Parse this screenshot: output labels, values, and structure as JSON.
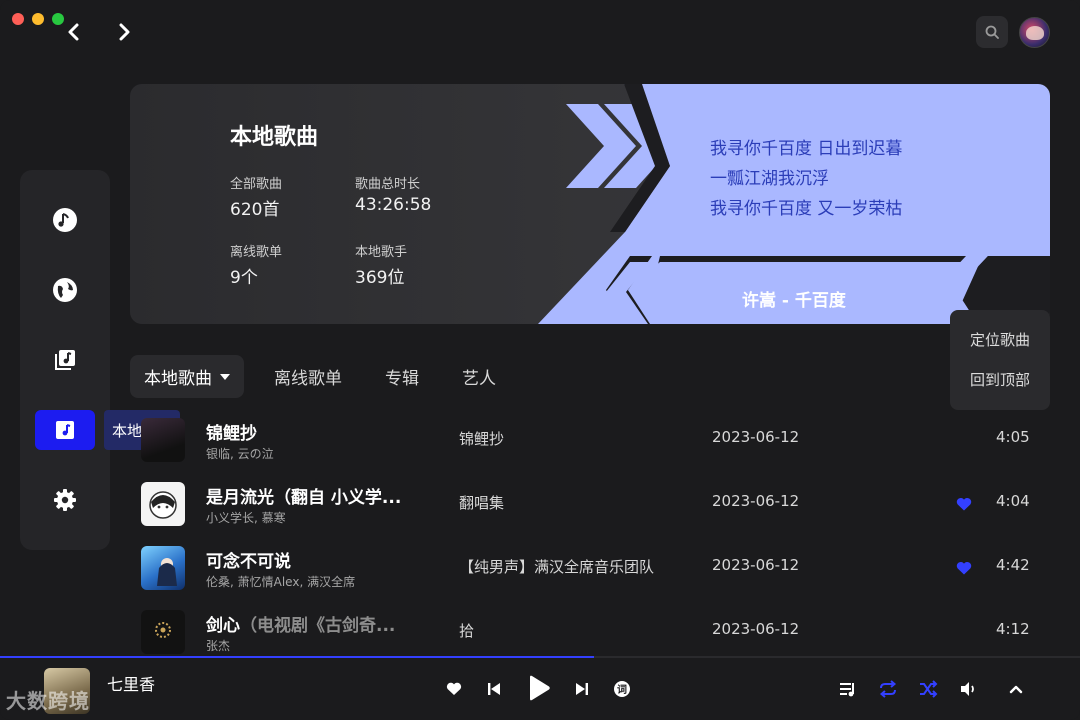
{
  "window": {
    "title": "本地音乐"
  },
  "sidebar": {
    "items": [
      {
        "icon": "music-note-circle-icon",
        "active": false
      },
      {
        "icon": "globe-icon",
        "active": false
      },
      {
        "icon": "music-library-icon",
        "active": false
      },
      {
        "icon": "local-music-icon",
        "active": true
      },
      {
        "icon": "gear-icon",
        "active": false
      }
    ],
    "tooltip": "本地音乐"
  },
  "banner": {
    "title": "本地歌曲",
    "stats": [
      {
        "label": "全部歌曲",
        "value": "620首"
      },
      {
        "label": "歌曲总时长",
        "value": "43:26:58"
      },
      {
        "label": "离线歌单",
        "value": "9个"
      },
      {
        "label": "本地歌手",
        "value": "369位"
      }
    ],
    "lyrics": [
      "我寻你千百度 日出到迟暮",
      "一瓢江湖我沉浮",
      "我寻你千百度 又一岁荣枯"
    ],
    "song_credit": "许嵩 - 千百度",
    "accent_color": "#aab8ff"
  },
  "tabs": [
    {
      "label": "本地歌曲",
      "active": true
    },
    {
      "label": "离线歌单",
      "active": false
    },
    {
      "label": "专辑",
      "active": false
    },
    {
      "label": "艺人",
      "active": false
    }
  ],
  "context_menu": {
    "items": [
      "定位歌曲",
      "回到顶部"
    ]
  },
  "songs": [
    {
      "title": "锦鲤抄",
      "title_sub": "",
      "artist": "银临, 云の泣",
      "album": "锦鲤抄",
      "date": "2023-06-12",
      "liked": false,
      "duration": "4:05"
    },
    {
      "title": "是月流光（翻自 小义学...",
      "title_sub": "",
      "artist": "小义学长, 慕寒",
      "album": "翻唱集",
      "date": "2023-06-12",
      "liked": true,
      "duration": "4:04"
    },
    {
      "title": "可念不可说",
      "title_sub": "",
      "artist": "伦桑, 萧忆情Alex, 满汉全席",
      "album": "【纯男声】满汉全席音乐团队",
      "date": "2023-06-12",
      "liked": true,
      "duration": "4:42"
    },
    {
      "title": "剑心",
      "title_sub": "（电视剧《古剑奇...",
      "artist": "张杰",
      "album": "拾",
      "date": "2023-06-12",
      "liked": false,
      "duration": "4:12"
    }
  ],
  "player": {
    "title": "七里香",
    "watermark": "大数跨境",
    "progress": 0.55,
    "like_color": "#ffffff",
    "accent_color": "#3340ff",
    "controls": [
      "heart-icon",
      "previous-icon",
      "play-icon",
      "next-icon",
      "lyrics-icon",
      "playlist-icon",
      "repeat-icon",
      "shuffle-icon",
      "volume-icon",
      "expand-icon"
    ]
  }
}
